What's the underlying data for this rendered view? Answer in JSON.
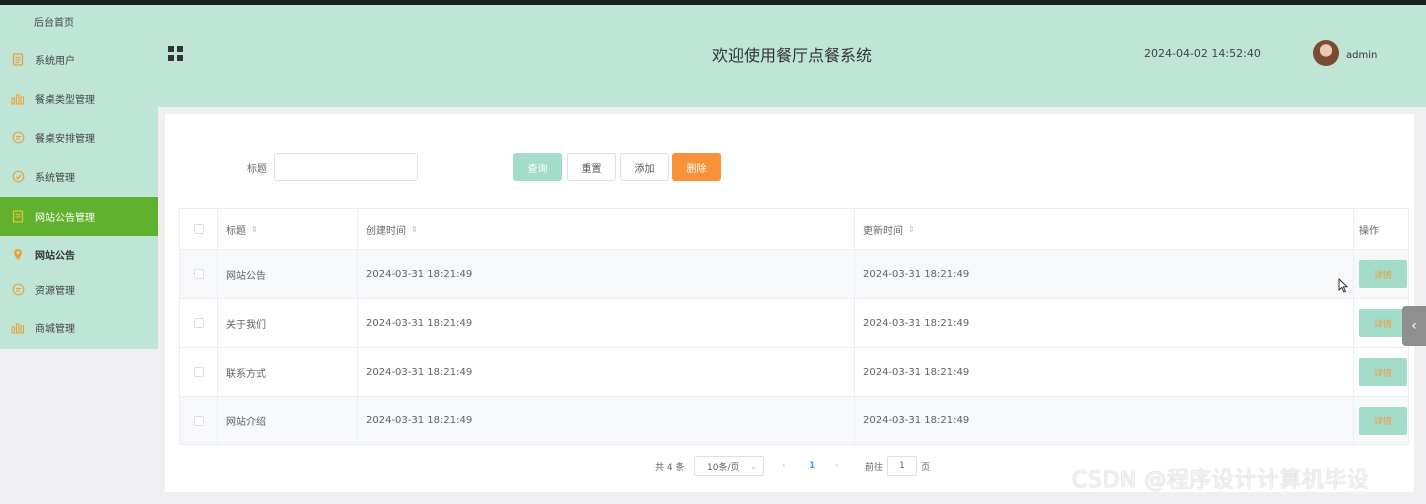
{
  "sidebar": {
    "home": "后台首页",
    "items": [
      {
        "label": "系统用户",
        "icon": "document-icon"
      },
      {
        "label": "餐桌类型管理",
        "icon": "bar-chart-icon"
      },
      {
        "label": "餐桌安排管理",
        "icon": "chat-icon"
      },
      {
        "label": "系统管理",
        "icon": "check-circle-icon"
      },
      {
        "label": "网站公告管理",
        "icon": "document-icon",
        "active": true
      },
      {
        "label": "网站公告",
        "icon": "location-pin-icon",
        "sub": true
      },
      {
        "label": "资源管理",
        "icon": "chat-icon"
      },
      {
        "label": "商城管理",
        "icon": "bar-chart-icon"
      }
    ]
  },
  "header": {
    "title": "欢迎使用餐厅点餐系统",
    "datetime": "2024-04-02 14:52:40",
    "username": "admin"
  },
  "search": {
    "label": "标题",
    "placeholder": "",
    "value": ""
  },
  "toolbar": {
    "query": "查询",
    "reset": "重置",
    "add": "添加",
    "delete": "删除"
  },
  "table": {
    "headers": {
      "title": "标题",
      "created": "创建时间",
      "updated": "更新时间",
      "actions": "操作"
    },
    "rows": [
      {
        "title": "网站公告",
        "created": "2024-03-31 18:21:49",
        "updated": "2024-03-31 18:21:49",
        "action": "详情"
      },
      {
        "title": "关于我们",
        "created": "2024-03-31 18:21:49",
        "updated": "2024-03-31 18:21:49",
        "action": "详情"
      },
      {
        "title": "联系方式",
        "created": "2024-03-31 18:21:49",
        "updated": "2024-03-31 18:21:49",
        "action": "详情"
      },
      {
        "title": "网站介绍",
        "created": "2024-03-31 18:21:49",
        "updated": "2024-03-31 18:21:49",
        "action": "详情"
      }
    ]
  },
  "pagination": {
    "total": "共 4 条",
    "page_size": "10条/页",
    "current": "1",
    "goto": "前往",
    "goto_value": "1",
    "page_unit": "页"
  },
  "watermark": "CSDN @程序设计计算机毕设",
  "colors": {
    "accent": "#bfe5d6",
    "active": "#5fb12e",
    "button": "#a3dcc9",
    "danger": "#f7913a"
  }
}
